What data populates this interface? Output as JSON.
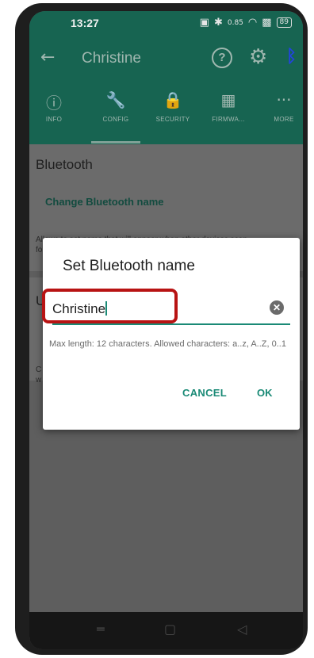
{
  "status": {
    "time": "13:27",
    "net_speed": "0.85",
    "battery": "89"
  },
  "appbar": {
    "title": "Christine"
  },
  "tabs": [
    {
      "label": "INFO"
    },
    {
      "label": "CONFIG"
    },
    {
      "label": "SECURITY"
    },
    {
      "label": "FIRMWA..."
    },
    {
      "label": "MORE"
    }
  ],
  "content": {
    "section_title": "Bluetooth",
    "change_link": "Change Bluetooth name",
    "description": "Allows to set name that will appear when other devices scan",
    "description_cont": "fo",
    "section2_initial": "U",
    "para_c": "C",
    "para_w": "w"
  },
  "dialog": {
    "title": "Set Bluetooth name",
    "input_value": "Christine",
    "hint": "Max length: 12 characters. Allowed characters: a..z, A..Z, 0..1",
    "cancel": "CANCEL",
    "ok": "OK"
  },
  "colors": {
    "accent": "#1a8a76",
    "appbar": "#176451",
    "highlight": "#b81313"
  }
}
